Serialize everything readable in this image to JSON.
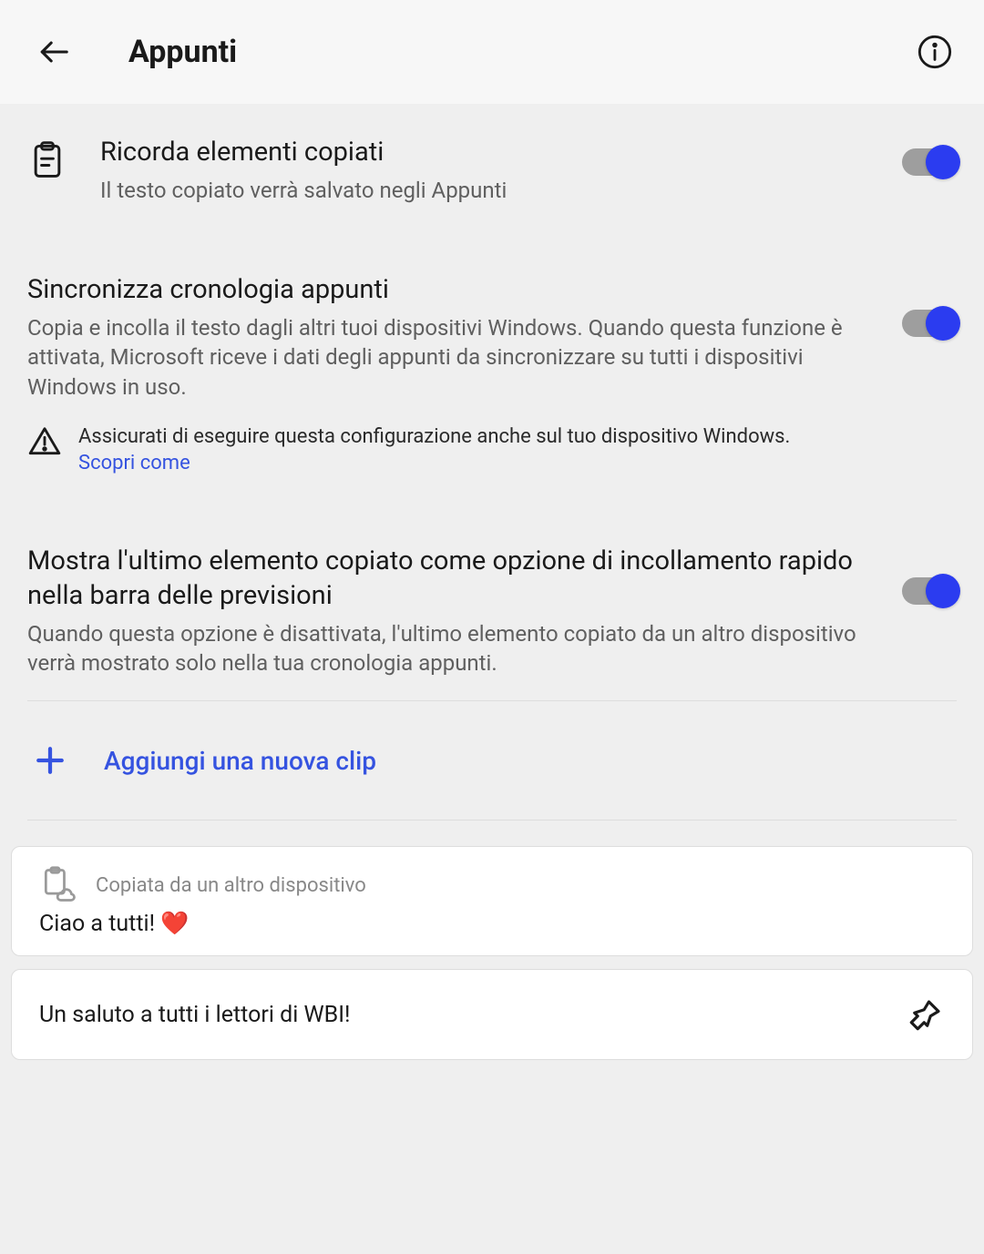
{
  "header": {
    "title": "Appunti"
  },
  "settings": {
    "remember": {
      "title": "Ricorda elementi copiati",
      "desc": "Il testo copiato verrà salvato negli Appunti"
    },
    "sync": {
      "title": "Sincronizza cronologia appunti",
      "desc": "Copia e incolla il testo dagli altri tuoi dispositivi Windows. Quando questa funzione è attivata, Microsoft riceve i dati degli appunti da sincronizzare su tutti i dispositivi Windows in uso.",
      "warning": "Assicurati di eseguire questa configurazione anche sul tuo dispositivo Windows.",
      "learn": "Scopri come"
    },
    "showLast": {
      "title": "Mostra l'ultimo elemento copiato come opzione di incollamento rapido nella barra delle previsioni",
      "desc": "Quando questa opzione è disattivata, l'ultimo elemento copiato da un altro dispositivo verrà mostrato solo nella tua cronologia appunti."
    }
  },
  "addClip": {
    "label": "Aggiungi una nuova clip"
  },
  "clips": [
    {
      "origin": "Copiata da un altro dispositivo",
      "text": "Ciao a tutti! ❤️"
    },
    {
      "text": "Un saluto a tutti i lettori di WBI!"
    }
  ]
}
